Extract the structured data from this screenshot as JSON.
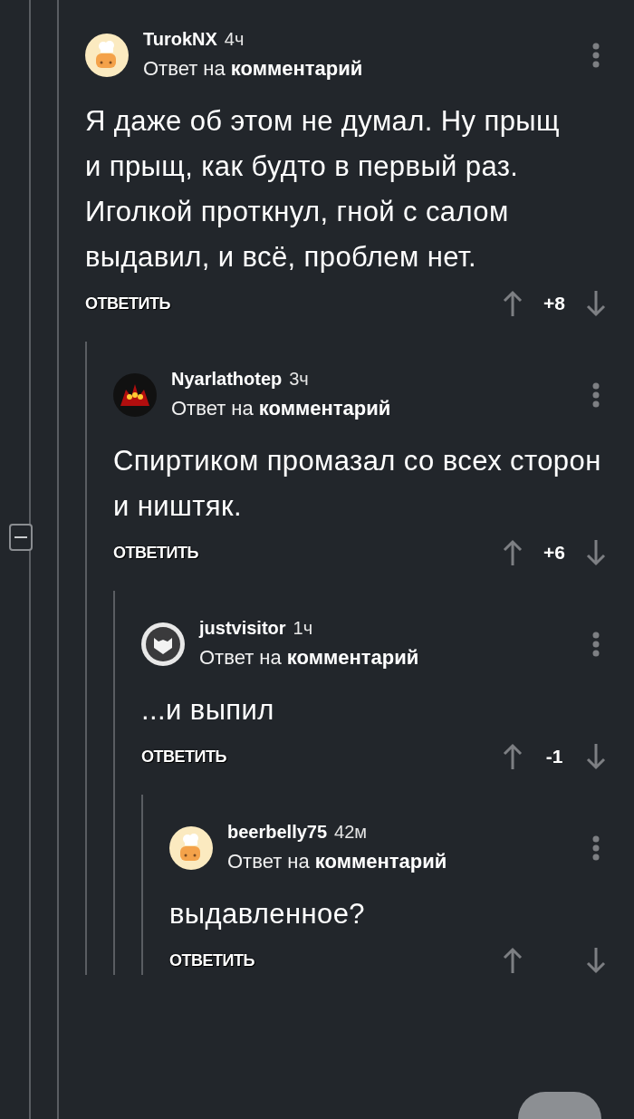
{
  "comments": [
    {
      "author": "TurokNX",
      "time": "4ч",
      "reply_to": "Ответ на **комментарий**",
      "text": "Я даже об этом не думал. Ну прыщ и прыщ, как будто в первый раз. Иголкой проткнул, гной с салом выдавил, и всё, проблем нет.",
      "reply_label": "ОТВЕТИТЬ",
      "score": "+8",
      "children": [
        {
          "author": "Nyarlathotep",
          "time": "3ч",
          "reply_to": "Ответ на **комментарий**",
          "text": "Спиртиком промазал со всех сторон и ништяк.",
          "reply_label": "ОТВЕТИТЬ",
          "score": "+6",
          "children": [
            {
              "author": "justvisitor",
              "time": "1ч",
              "reply_to": "Ответ на **комментарий**",
              "text": "...и выпил",
              "reply_label": "ОТВЕТИТЬ",
              "score": "-1",
              "children": [
                {
                  "author": "beerbelly75",
                  "time": "42м",
                  "reply_to": "Ответ на **комментарий**",
                  "text": "выдавленное?",
                  "reply_label": "ОТВЕТИТЬ"
                }
              ]
            }
          ]
        }
      ]
    }
  ]
}
